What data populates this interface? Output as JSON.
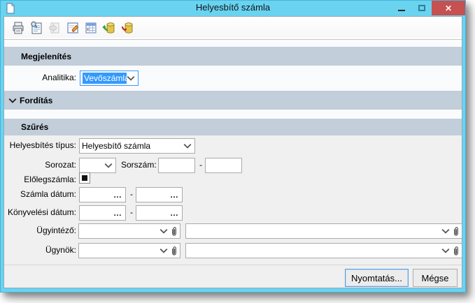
{
  "window": {
    "title": "Helyesbítő számla",
    "controls": {
      "minimize": "minimize",
      "maximize": "maximize",
      "close": "✕"
    }
  },
  "toolbar": {
    "icons": [
      "print",
      "print-preview",
      "export-disabled",
      "edit",
      "table",
      "database-import",
      "database-export"
    ]
  },
  "sections": {
    "display": {
      "title": "Megjelenítés",
      "analytics_label": "Analitika:",
      "analytics_value": "Vevőszámla"
    },
    "translation": {
      "title": "Fordítás"
    },
    "filter": {
      "title": "Szűrés",
      "type_label": "Helyesbítés típus:",
      "type_value": "Helyesbítő számla",
      "series_label": "Sorozat:",
      "series_value": "",
      "serial_label": "Sorszám:",
      "serial_from": "",
      "serial_to": "",
      "range_separator": "-",
      "advance_label": "Előlegszámla:",
      "advance_checked": "mixed",
      "invoice_date_label": "Számla dátum:",
      "invoice_date_from": "",
      "invoice_date_to": "",
      "accounting_date_label": "Könyvelési dátum:",
      "accounting_date_from": "",
      "accounting_date_to": "",
      "clerk_label": "Ügyintéző:",
      "clerk_value": "",
      "clerk_name_value": "",
      "agent_label": "Ügynök:",
      "agent_value": "",
      "agent_name_value": "",
      "ellipsis": "…"
    }
  },
  "footer": {
    "print": "Nyomtatás...",
    "cancel": "Mégse"
  },
  "colors": {
    "titlebar": "#69D3F0",
    "close_button": "#C75050",
    "section_band": "#C2CEDA",
    "form_background": "#F0F0F0",
    "selection": "#3399FF",
    "field_border": "#ABABAB"
  }
}
